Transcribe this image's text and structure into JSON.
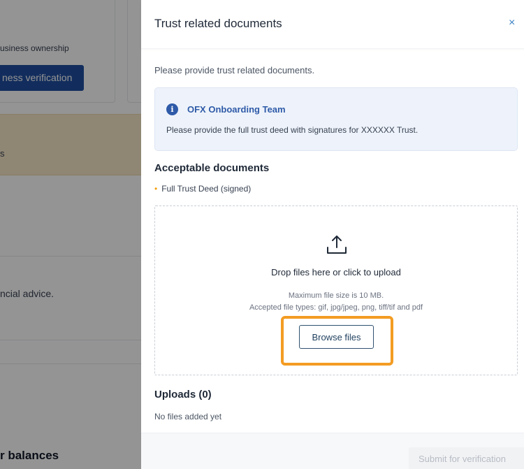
{
  "background": {
    "ownership_text": "usiness ownership",
    "verification_button": "ness verification",
    "warning_text": "s",
    "advice_text": "ncial advice.",
    "balances_heading": "r balances"
  },
  "drawer": {
    "title": "Trust related documents",
    "close_label": "×",
    "intro": "Please provide trust related documents.",
    "notice": {
      "icon": "info-icon",
      "icon_glyph": "i",
      "title": "OFX Onboarding Team",
      "body": "Please provide the full trust deed with signatures for XXXXXX Trust."
    },
    "acceptable": {
      "title": "Acceptable documents",
      "bullet": "•",
      "items": [
        "Full Trust Deed (signed)"
      ]
    },
    "dropzone": {
      "icon": "upload-icon",
      "main_text": "Drop files here or click to upload",
      "max_size": "Maximum file size is 10 MB.",
      "file_types": "Accepted file types: gif, jpg/jpeg, png, tiff/tif and pdf",
      "browse_label": "Browse files"
    },
    "uploads": {
      "title": "Uploads (0)",
      "empty_text": "No files added yet"
    },
    "footer": {
      "submit_label": "Submit for verification"
    }
  },
  "colors": {
    "accent": "#2e5aa8",
    "highlight": "#f39c23",
    "bullet": "#f59e0b"
  }
}
